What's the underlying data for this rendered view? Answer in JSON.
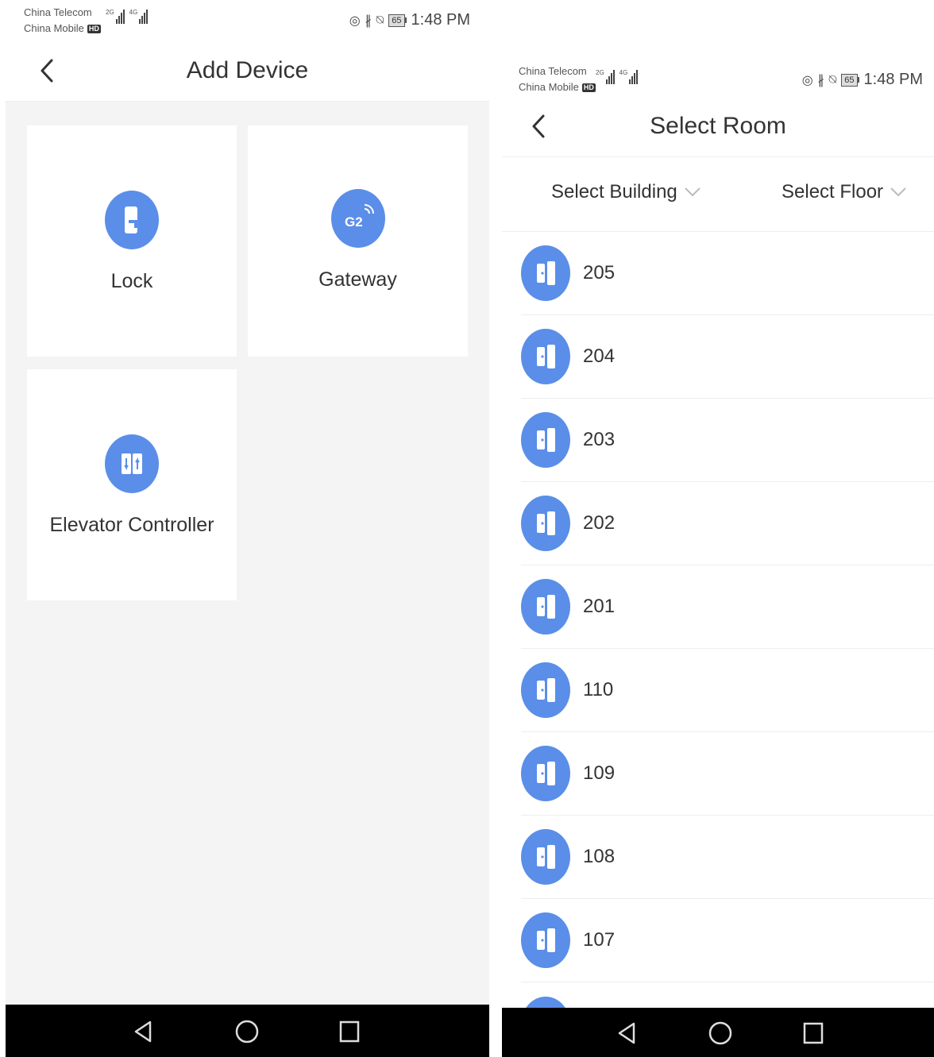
{
  "status": {
    "carrier_1": "China Telecom",
    "carrier_2": "China Mobile",
    "hd_badge": "HD",
    "net_1": "2G",
    "net_2": "4G",
    "battery": "65",
    "time": "1:48 PM"
  },
  "add_device": {
    "title": "Add Device",
    "tiles": [
      {
        "label": "Lock",
        "icon": "lock-icon"
      },
      {
        "label": "Gateway",
        "icon": "gateway-icon",
        "icon_text": "G2"
      },
      {
        "label": "Elevator Controller",
        "icon": "elevator-icon"
      }
    ]
  },
  "select_room": {
    "title": "Select Room",
    "filters": {
      "building": "Select Building",
      "floor": "Select Floor"
    },
    "rooms": [
      "205",
      "204",
      "203",
      "202",
      "201",
      "110",
      "109",
      "108",
      "107"
    ]
  },
  "colors": {
    "accent": "#5a8ee8",
    "background": "#f4f4f4",
    "navbar": "#000000"
  }
}
